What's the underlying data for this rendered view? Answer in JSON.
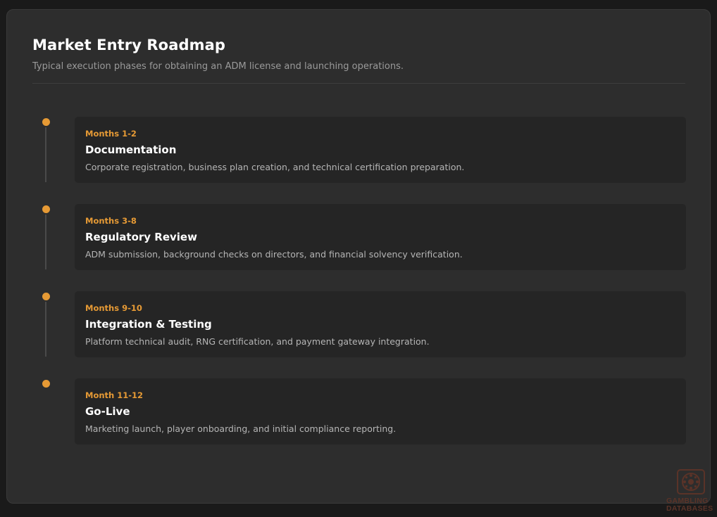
{
  "header": {
    "title": "Market Entry Roadmap",
    "subtitle": "Typical execution phases for obtaining an ADM license and launching operations."
  },
  "timeline": [
    {
      "phase": "Months 1-2",
      "title": "Documentation",
      "description": "Corporate registration, business plan creation, and technical certification preparation."
    },
    {
      "phase": "Months 3-8",
      "title": "Regulatory Review",
      "description": "ADM submission, background checks on directors, and financial solvency verification."
    },
    {
      "phase": "Months 9-10",
      "title": "Integration & Testing",
      "description": "Platform technical audit, RNG certification, and payment gateway integration."
    },
    {
      "phase": "Month 11-12",
      "title": "Go-Live",
      "description": "Marketing launch, player onboarding, and initial compliance reporting."
    }
  ],
  "watermark": {
    "line1": "GAMBLING",
    "line2": "DATABASES",
    "icon": "roulette-wheel-icon"
  },
  "colors": {
    "accent": "#e69a35",
    "panel": "#2d2d2d",
    "card": "#252525",
    "background": "#1a1a1a"
  }
}
